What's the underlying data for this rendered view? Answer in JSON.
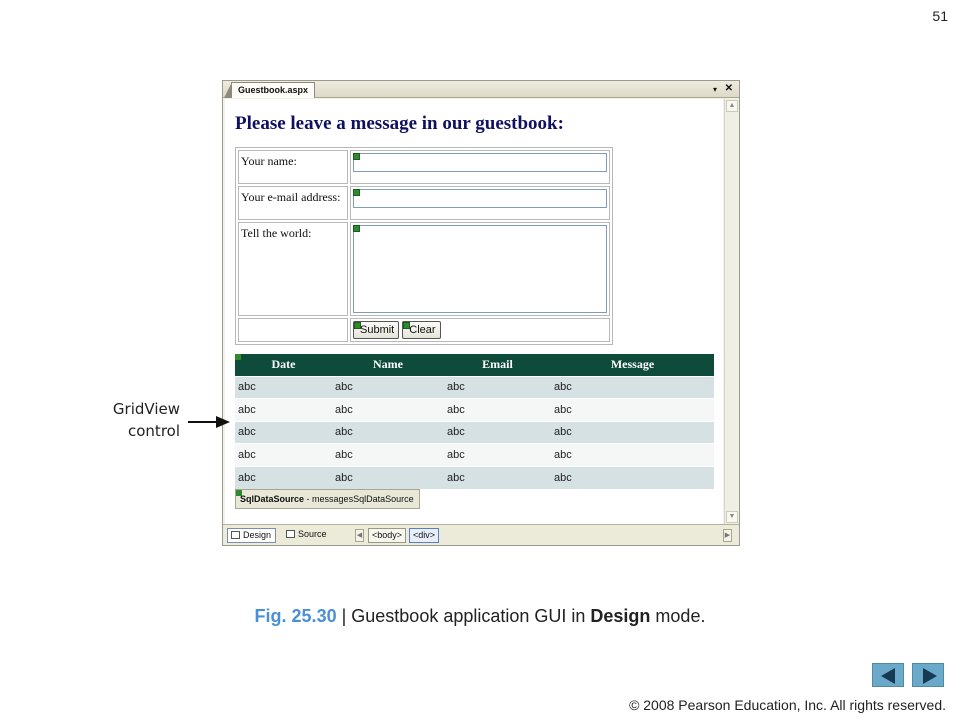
{
  "slide": {
    "number": "51"
  },
  "ide": {
    "document_tab": "Guestbook.aspx",
    "controls": {
      "dropdown": "▾",
      "close": "✕"
    },
    "page_heading": "Please leave a message in our guestbook:",
    "form": {
      "name_label": "Your name:",
      "email_label": "Your e-mail address:",
      "message_label": "Tell the world:",
      "submit_label": "Submit",
      "clear_label": "Clear"
    },
    "gridview": {
      "columns": [
        "Date",
        "Name",
        "Email",
        "Message"
      ],
      "rows": [
        [
          "abc",
          "abc",
          "abc",
          "abc"
        ],
        [
          "abc",
          "abc",
          "abc",
          "abc"
        ],
        [
          "abc",
          "abc",
          "abc",
          "abc"
        ],
        [
          "abc",
          "abc",
          "abc",
          "abc"
        ],
        [
          "abc",
          "abc",
          "abc",
          "abc"
        ]
      ]
    },
    "sqldatasource": {
      "type": "SqlDataSource",
      "name": "- messagesSqlDataSource"
    },
    "bottom_bar": {
      "design_tab": "Design",
      "source_tab": "Source",
      "tags": [
        "<body>",
        "<div>"
      ]
    }
  },
  "annotation": {
    "line1": "GridView",
    "line2": "control"
  },
  "caption": {
    "fig": "Fig. 25.30",
    "sep": " | Guestbook application GUI in ",
    "bold": "Design",
    "tail": " mode."
  },
  "copyright": "© 2008 Pearson Education, Inc.  All rights reserved.",
  "colors": {
    "grid_header": "#0f4b3a",
    "grid_alt_row": "#d6e1e3",
    "heading_text": "#101060",
    "caption_fig": "#4a90d6"
  },
  "icons": {
    "prev": "left-arrow-icon",
    "next": "right-arrow-icon"
  }
}
